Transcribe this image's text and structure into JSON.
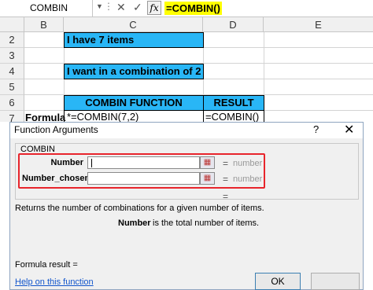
{
  "formula_bar": {
    "name_box": "COMBIN",
    "dots": "⋮",
    "cancel_icon": "✕",
    "enter_icon": "✓",
    "fx": "fx",
    "formula": "=COMBIN()"
  },
  "columns": [
    "B",
    "C",
    "D",
    "E"
  ],
  "rows": [
    "2",
    "3",
    "4",
    "5",
    "6",
    "7"
  ],
  "cells": {
    "c2": "I have 7 items",
    "c4": "I want in a combination of 2",
    "c6": "COMBIN FUNCTION",
    "d6": "RESULT",
    "b7": "Formula",
    "c7": "*=COMBIN(7,2)",
    "d7": "=COMBIN()"
  },
  "dialog": {
    "title": "Function Arguments",
    "help": "?",
    "close": "✕",
    "function_name": "COMBIN",
    "args": [
      {
        "label": "Number",
        "value": "",
        "eq": "=",
        "result": "number"
      },
      {
        "label": "Number_chosen",
        "value": "",
        "eq": "=",
        "result": "number"
      }
    ],
    "result_eq": "=",
    "description": "Returns the number of combinations for a given number of items.",
    "detail_name": "Number",
    "detail_text": "is the total number of items.",
    "formula_result": "Formula result =",
    "help_link": "Help on this function",
    "ok": "OK"
  },
  "colors": {
    "cell_fill": "#29b6f6",
    "formula_highlight": "#ffff00",
    "callout_border": "#e8252c"
  }
}
